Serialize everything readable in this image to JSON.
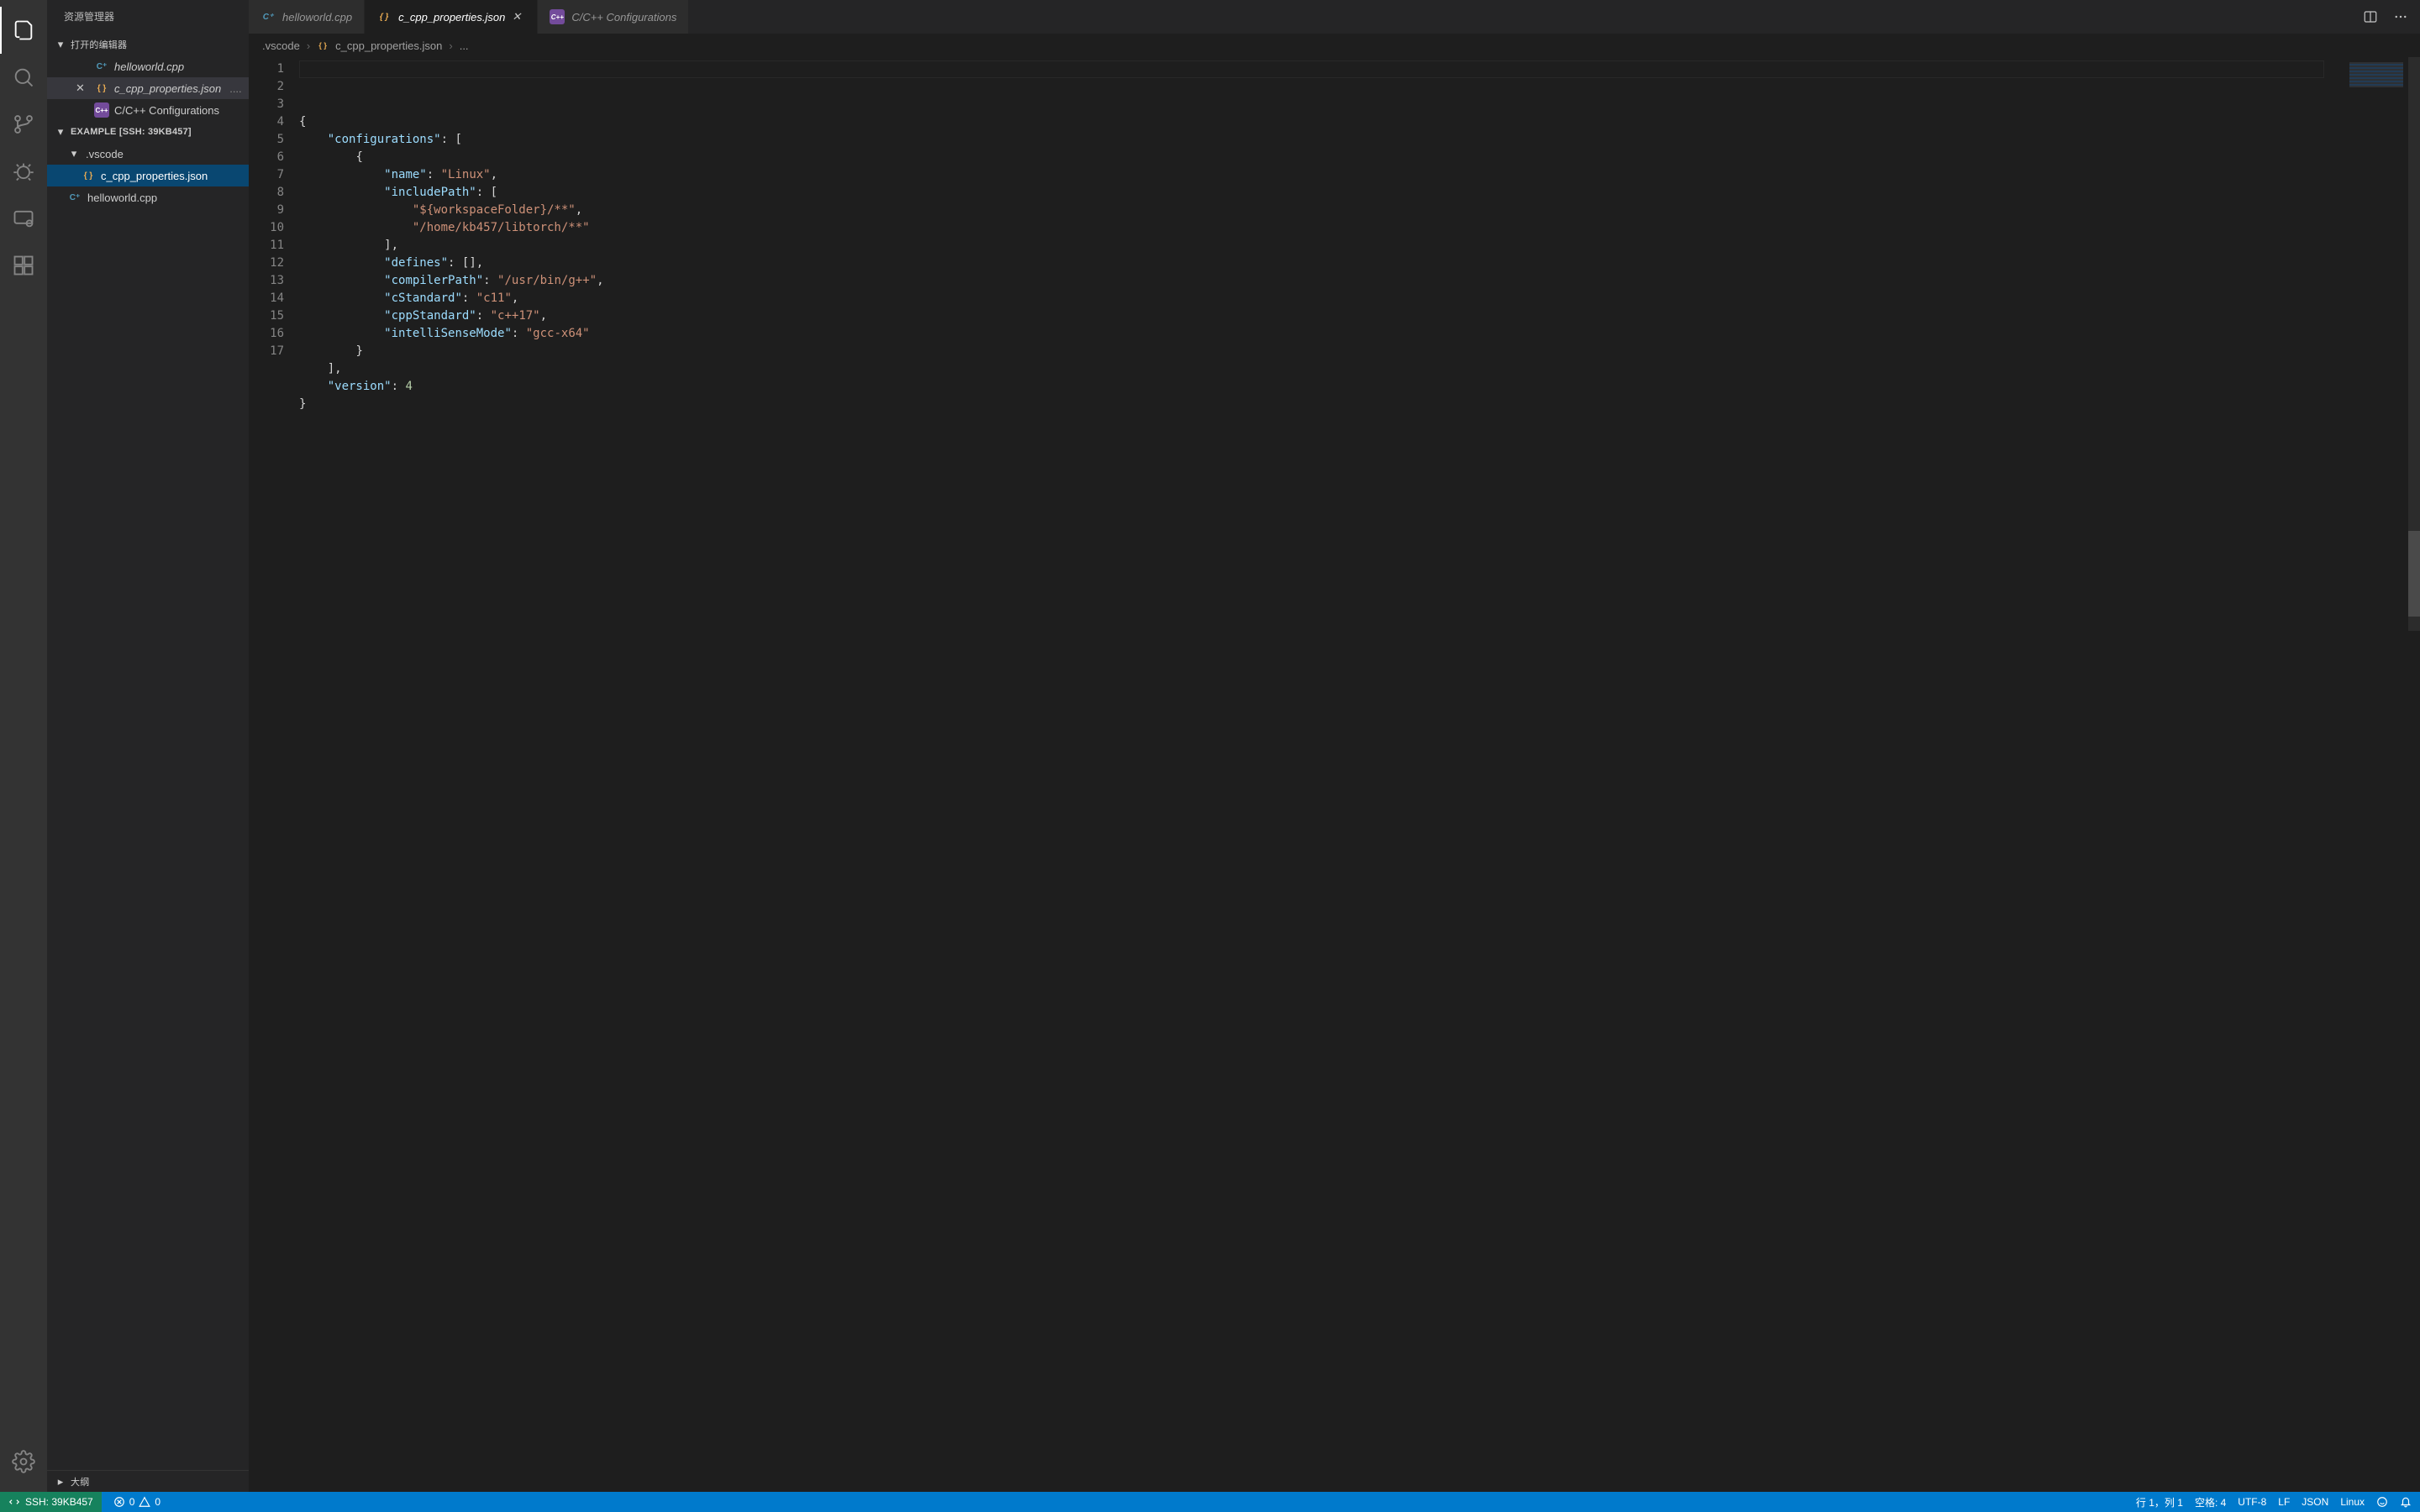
{
  "sidebar": {
    "title": "资源管理器",
    "openEditorsHeader": "打开的编辑器",
    "openEditors": [
      {
        "icon": "cpp",
        "name": "helloworld.cpp",
        "dirty": false
      },
      {
        "icon": "json",
        "name": "c_cpp_properties.json",
        "path": "....",
        "dirty": false,
        "active": true
      },
      {
        "icon": "cfg",
        "name": "C/C++ Configurations",
        "dirty": false
      }
    ],
    "folderHeader": "EXAMPLE [SSH: 39KB457]",
    "tree": {
      "folder": ".vscode",
      "files": [
        {
          "icon": "json",
          "name": "c_cpp_properties.json",
          "selected": true
        }
      ],
      "rootFiles": [
        {
          "icon": "cpp",
          "name": "helloworld.cpp"
        }
      ]
    },
    "outlineHeader": "大纲"
  },
  "tabs": [
    {
      "icon": "cpp",
      "label": "helloworld.cpp",
      "active": false
    },
    {
      "icon": "json",
      "label": "c_cpp_properties.json",
      "active": true,
      "closable": true
    },
    {
      "icon": "cfg",
      "label": "C/C++ Configurations",
      "active": false
    }
  ],
  "breadcrumbs": {
    "seg1": ".vscode",
    "seg2": "c_cpp_properties.json",
    "seg3": "..."
  },
  "editor": {
    "lineCount": 17,
    "lines": [
      "{",
      "    \"configurations\": [",
      "        {",
      "            \"name\": \"Linux\",",
      "            \"includePath\": [",
      "                \"${workspaceFolder}/**\",",
      "                \"/home/kb457/libtorch/**\"",
      "            ],",
      "            \"defines\": [],",
      "            \"compilerPath\": \"/usr/bin/g++\",",
      "            \"cStandard\": \"c11\",",
      "            \"cppStandard\": \"c++17\",",
      "            \"intelliSenseMode\": \"gcc-x64\"",
      "        }",
      "    ],",
      "    \"version\": 4",
      "}"
    ]
  },
  "statusbar": {
    "ssh": "SSH: 39KB457",
    "errors": "0",
    "warnings": "0",
    "lncol": "行 1，列 1",
    "spaces": "空格: 4",
    "encoding": "UTF-8",
    "eol": "LF",
    "language": "JSON",
    "os": "Linux"
  }
}
